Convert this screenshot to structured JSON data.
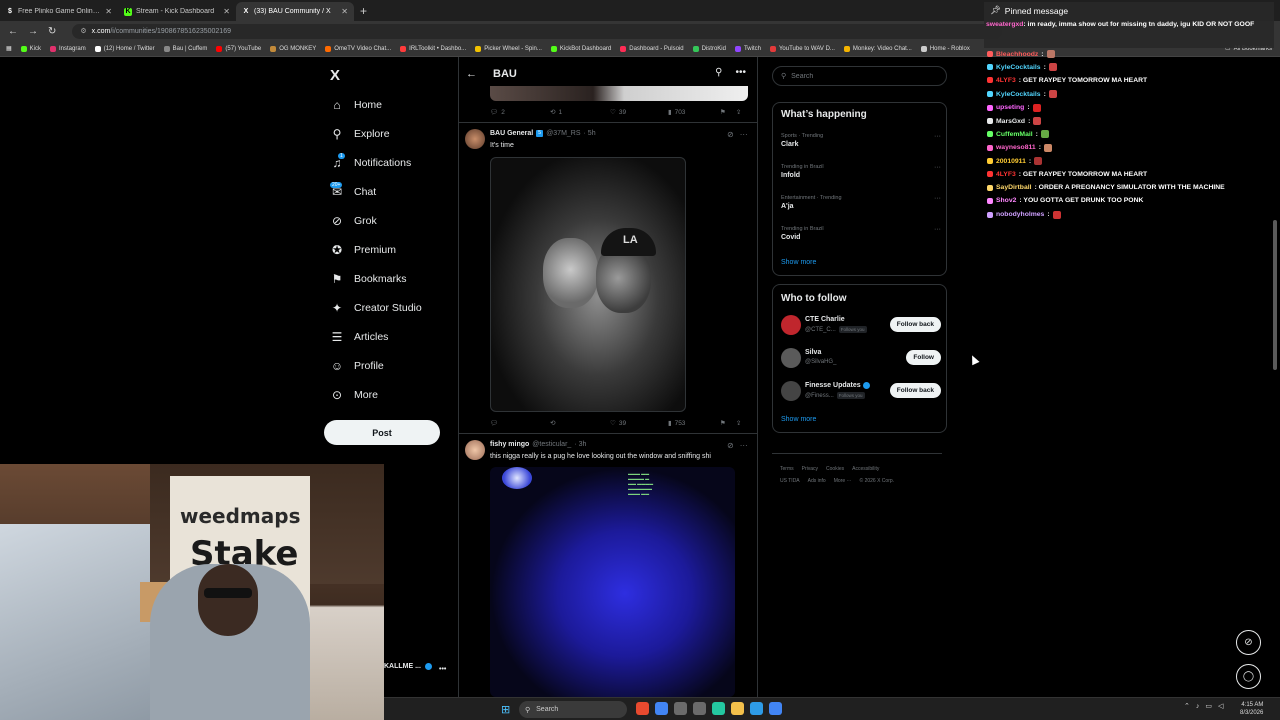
{
  "browser": {
    "tabs": [
      {
        "title": "Free Plinko Game Online - Play",
        "favicon_color": "#2b2b2b",
        "glyph": "$"
      },
      {
        "title": "Stream - Kick Dashboard",
        "favicon_color": "#53fc18",
        "glyph": "K"
      },
      {
        "title": "(33) BAU Community / X",
        "favicon_color": "#000000",
        "glyph": "X",
        "active": true
      }
    ],
    "url_host": "x.com",
    "url_path": "/i/communities/1908678516235002169",
    "bookmarks": [
      {
        "label": "Kick",
        "color": "#53fc18"
      },
      {
        "label": "Instagram",
        "color": "#e1306c"
      },
      {
        "label": "(12) Home / Twitter",
        "color": "#ffffff"
      },
      {
        "label": "Bau | Cuffem",
        "color": "#888888"
      },
      {
        "label": "(57) YouTube",
        "color": "#ff0000"
      },
      {
        "label": "OG MONKEY",
        "color": "#c28a3a"
      },
      {
        "label": "OmeTV Video Chat...",
        "color": "#ff6a00"
      },
      {
        "label": "IRLToolkit • Dashbo...",
        "color": "#ff3b3b"
      },
      {
        "label": "Picker Wheel - Spin...",
        "color": "#f2c200"
      },
      {
        "label": "KickBot Dashboard",
        "color": "#53fc18"
      },
      {
        "label": "Dashboard - Pulsoid",
        "color": "#ff2c55"
      },
      {
        "label": "DistroKid",
        "color": "#35c759"
      },
      {
        "label": "Twitch",
        "color": "#9146ff"
      },
      {
        "label": "YouTube to WAV D...",
        "color": "#e33a3a"
      },
      {
        "label": "Monkey: Video Chat...",
        "color": "#f5b400"
      },
      {
        "label": "Home - Roblox",
        "color": "#cccccc"
      }
    ],
    "all_bookmarks": "All Bookmarks"
  },
  "nav": {
    "logo": "X",
    "items": [
      {
        "label": "Home",
        "icon": "⌂",
        "name": "home"
      },
      {
        "label": "Explore",
        "icon": "⚲",
        "name": "explore"
      },
      {
        "label": "Notifications",
        "icon": "🔔",
        "name": "notifications",
        "badge": "1"
      },
      {
        "label": "Chat",
        "icon": "✉",
        "name": "chat",
        "badge": "20+"
      },
      {
        "label": "Grok",
        "icon": "⊘",
        "name": "grok"
      },
      {
        "label": "Premium",
        "icon": "✪",
        "name": "premium"
      },
      {
        "label": "Bookmarks",
        "icon": "⚑",
        "name": "bookmarks"
      },
      {
        "label": "Creator Studio",
        "icon": "✦",
        "name": "creator-studio"
      },
      {
        "label": "Articles",
        "icon": "☰",
        "name": "articles"
      },
      {
        "label": "Profile",
        "icon": "☺",
        "name": "profile"
      },
      {
        "label": "More",
        "icon": "⋯",
        "name": "more"
      }
    ],
    "post_label": "Post",
    "account_name": "KALLME ...",
    "more": "•••"
  },
  "community": {
    "back": "←",
    "name": "BAU",
    "search_icon": "⚲",
    "more_icon": "•••"
  },
  "prev_tweet_actions": {
    "replies": "2",
    "reposts": "1",
    "likes": "39",
    "views": "703"
  },
  "tweets": [
    {
      "author": "BAU General",
      "badge": "5",
      "handle": "@37M_RS",
      "time": "· 5h",
      "text": "It's time",
      "replies": "",
      "reposts": "",
      "likes": "39",
      "views": "753",
      "photo_logo": "LA"
    },
    {
      "author": "fishy mingo",
      "handle": "@testicular_",
      "time": "· 3h",
      "text": "this nigga really is a pug he love looking out the window and sniffing shi"
    }
  ],
  "sidebar": {
    "search_placeholder": "Search",
    "happening_title": "What’s happening",
    "trends": [
      {
        "category": "Sports · Trending",
        "topic": "Clark"
      },
      {
        "category": "Trending in Brazil",
        "topic": "Infold"
      },
      {
        "category": "Entertainment · Trending",
        "topic": "A'ja"
      },
      {
        "category": "Trending in Brazil",
        "topic": "Covid"
      }
    ],
    "show_more": "Show more",
    "follow_title": "Who to follow",
    "follows": [
      {
        "name": "CTE Charlie",
        "handle": "@CTE_C...",
        "follows_you": "Follows you",
        "button": "Follow back",
        "avatar": "#c0262d"
      },
      {
        "name": "Silva",
        "handle": "@SilvaHG_",
        "follows_you": "",
        "button": "Follow",
        "avatar": "#5a5a5a"
      },
      {
        "name": "Finesse Updates",
        "handle": "@Finess...",
        "follows_you": "Follows you",
        "button": "Follow back",
        "avatar": "#444444",
        "verified": true
      }
    ],
    "show_more_2": "Show more",
    "footer": [
      "Terms",
      "Privacy",
      "Cookies",
      "Accessibility",
      "US TIDA",
      "Ads info",
      "More ···",
      "© 2026 X Corp."
    ]
  },
  "chat": {
    "pinned_title": "Pinned message",
    "pinned_user": "sweatergxd",
    "pinned_text": ": im ready, imma show out for missing tn daddy, igu KID OR NOT GOOF",
    "messages": [
      {
        "user": "Bleachhoodz",
        "color": "#ff5c5c",
        "text": ":",
        "emote": "#bb7766"
      },
      {
        "user": "KyleCocktails",
        "color": "#52d6ff",
        "text": ":",
        "emote": "#cc4444"
      },
      {
        "user": "4LYF3",
        "color": "#ff3333",
        "text": ": GET RAYPEY TOMORROW MA HEART",
        "emote": ""
      },
      {
        "user": "KyleCocktails",
        "color": "#52d6ff",
        "text": ":",
        "emote": "#cc4444"
      },
      {
        "user": "upseting",
        "color": "#ff66ff",
        "text": ":",
        "emote": "#dd2222"
      },
      {
        "user": "MarsGxd",
        "color": "#e7e9ea",
        "text": ":",
        "emote": "#cc4444"
      },
      {
        "user": "CuffemMail",
        "color": "#66ff66",
        "text": ":",
        "emote": "#66aa44"
      },
      {
        "user": "wayneso811",
        "color": "#ff66cc",
        "text": ":",
        "emote": "#cc8866"
      },
      {
        "user": "20010911",
        "color": "#ffcc33",
        "text": ":",
        "emote": "#aa3333"
      },
      {
        "user": "4LYF3",
        "color": "#ff3333",
        "text": ": GET RAYPEY TOMORROW MA HEART",
        "emote": ""
      },
      {
        "user": "SayDirtball",
        "color": "#ffd86b",
        "text": ": ORDER A PREGNANCY SIMULATOR WITH THE MACHINE",
        "emote": ""
      },
      {
        "user": "Shov2",
        "color": "#ff88ff",
        "text": ": YOU GOTTA GET DRUNK TOO PONK",
        "emote": ""
      },
      {
        "user": "nobodyholmes",
        "color": "#cfa0ff",
        "text": ":",
        "emote": "#cc3333"
      }
    ]
  },
  "taskbar": {
    "search": "Search",
    "time": "4:15 AM",
    "date": "8/3/2026",
    "apps": [
      "#e84a2f",
      "#4285f4",
      "#6b6b6b",
      "#6b6b6b",
      "#24c8a0",
      "#f3c04b",
      "#2e9be6",
      "#4285f4"
    ]
  },
  "webcam": {
    "brand1": "weedmaps",
    "brand2": "Stake"
  }
}
